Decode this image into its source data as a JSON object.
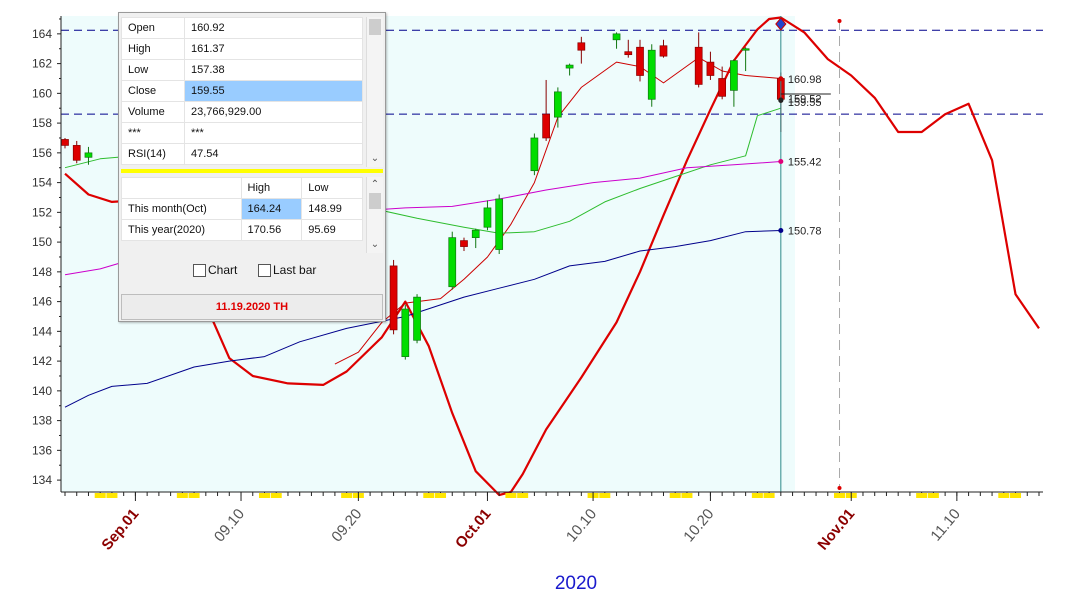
{
  "chart_data": {
    "type": "candlestick",
    "year_label": "2020",
    "x_tick_labels": [
      {
        "date": "2020-09-01",
        "label": "Sep.01",
        "month_start": true
      },
      {
        "date": "2020-09-10",
        "label": "09.10",
        "month_start": false
      },
      {
        "date": "2020-09-20",
        "label": "09.20",
        "month_start": false
      },
      {
        "date": "2020-10-01",
        "label": "Oct.01",
        "month_start": true
      },
      {
        "date": "2020-10-10",
        "label": "10.10",
        "month_start": false
      },
      {
        "date": "2020-10-20",
        "label": "10.20",
        "month_start": false
      },
      {
        "date": "2020-11-01",
        "label": "Nov.01",
        "month_start": true
      },
      {
        "date": "2020-11-10",
        "label": "11.10",
        "month_start": false
      }
    ],
    "y_ticks": [
      134,
      136,
      138,
      140,
      142,
      144,
      146,
      148,
      150,
      152,
      154,
      156,
      158,
      160,
      162,
      164
    ],
    "ylim": [
      133.2,
      165.2
    ],
    "x_domain": [
      "2020-08-26",
      "2020-11-17"
    ],
    "last_date": "2020-10-26",
    "forecast_marker_date": "2020-10-31",
    "horizontal_lines": [
      164.24,
      158.6
    ],
    "price_labels": [
      {
        "label": "160.98",
        "value": 160.98,
        "color": "#d00000"
      },
      {
        "label": "159.52",
        "value": 159.52,
        "color": "#222222"
      },
      {
        "label": "159.55",
        "value": 159.55,
        "color": "#222222"
      },
      {
        "label": "155.42",
        "value": 155.42,
        "color": "#e0007a"
      },
      {
        "label": "150.78",
        "value": 150.78,
        "color": "#00008b"
      }
    ],
    "candles": [
      {
        "date": "2020-08-26",
        "open": 156.9,
        "high": 157.0,
        "low": 156.3,
        "close": 156.5
      },
      {
        "date": "2020-08-27",
        "open": 156.5,
        "high": 156.8,
        "low": 155.3,
        "close": 155.5
      },
      {
        "date": "2020-08-28",
        "open": 155.7,
        "high": 156.4,
        "low": 155.2,
        "close": 156.0
      },
      {
        "date": "2020-08-31",
        "open": 156.5,
        "high": 157.3,
        "low": 156.2,
        "close": 157.1
      },
      {
        "date": "2020-09-22",
        "open": 149.1,
        "high": 149.3,
        "low": 148.6,
        "close": 148.7
      },
      {
        "date": "2020-09-23",
        "open": 148.4,
        "high": 148.8,
        "low": 143.8,
        "close": 144.1
      },
      {
        "date": "2020-09-24",
        "open": 142.3,
        "high": 145.8,
        "low": 142.1,
        "close": 145.5
      },
      {
        "date": "2020-09-25",
        "open": 143.4,
        "high": 146.5,
        "low": 143.2,
        "close": 146.3
      },
      {
        "date": "2020-09-28",
        "open": 147.0,
        "high": 150.7,
        "low": 146.8,
        "close": 150.3
      },
      {
        "date": "2020-09-29",
        "open": 150.1,
        "high": 150.3,
        "low": 149.4,
        "close": 149.7
      },
      {
        "date": "2020-09-30",
        "open": 150.3,
        "high": 150.9,
        "low": 149.6,
        "close": 150.8
      },
      {
        "date": "2020-10-01",
        "open": 151.0,
        "high": 152.8,
        "low": 150.8,
        "close": 152.3
      },
      {
        "date": "2020-10-02",
        "open": 149.5,
        "high": 153.2,
        "low": 149.2,
        "close": 152.9
      },
      {
        "date": "2020-10-05",
        "open": 154.8,
        "high": 157.3,
        "low": 154.5,
        "close": 157.0
      },
      {
        "date": "2020-10-06",
        "open": 158.6,
        "high": 160.9,
        "low": 156.8,
        "close": 157.0
      },
      {
        "date": "2020-10-07",
        "open": 158.4,
        "high": 160.4,
        "low": 157.7,
        "close": 160.1
      },
      {
        "date": "2020-10-08",
        "open": 161.7,
        "high": 162.0,
        "low": 161.2,
        "close": 161.9
      },
      {
        "date": "2020-10-09",
        "open": 163.4,
        "high": 163.8,
        "low": 162.0,
        "close": 162.9
      },
      {
        "date": "2020-10-12",
        "open": 163.6,
        "high": 164.1,
        "low": 163.0,
        "close": 164.0
      },
      {
        "date": "2020-10-13",
        "open": 162.8,
        "high": 163.6,
        "low": 162.4,
        "close": 162.6
      },
      {
        "date": "2020-10-14",
        "open": 163.1,
        "high": 163.6,
        "low": 160.8,
        "close": 161.2
      },
      {
        "date": "2020-10-15",
        "open": 159.6,
        "high": 163.3,
        "low": 159.1,
        "close": 162.9
      },
      {
        "date": "2020-10-16",
        "open": 163.2,
        "high": 163.6,
        "low": 162.4,
        "close": 162.5
      },
      {
        "date": "2020-10-19",
        "open": 163.1,
        "high": 164.1,
        "low": 160.4,
        "close": 160.6
      },
      {
        "date": "2020-10-20",
        "open": 162.1,
        "high": 162.8,
        "low": 160.9,
        "close": 161.2
      },
      {
        "date": "2020-10-21",
        "open": 161.0,
        "high": 161.8,
        "low": 159.6,
        "close": 159.8
      },
      {
        "date": "2020-10-22",
        "open": 160.2,
        "high": 162.3,
        "low": 159.1,
        "close": 162.2
      },
      {
        "date": "2020-10-23",
        "open": 163.0,
        "high": 163.1,
        "low": 161.5,
        "close": 163.0
      },
      {
        "date": "2020-10-26",
        "open": 161.0,
        "high": 161.4,
        "low": 157.4,
        "close": 159.6
      }
    ],
    "series": [
      {
        "color": "#dd0000",
        "width": 2.2,
        "points": [
          [
            "2020-08-26",
            154.6
          ],
          [
            "2020-08-28",
            153.2
          ],
          [
            "2020-08-30",
            152.7
          ],
          [
            "2020-09-01",
            152.8
          ],
          [
            "2020-09-03",
            153.5
          ],
          [
            "2020-09-05",
            152.0
          ],
          [
            "2020-09-07",
            145.8
          ],
          [
            "2020-09-09",
            142.2
          ],
          [
            "2020-09-11",
            141.0
          ],
          [
            "2020-09-14",
            140.5
          ],
          [
            "2020-09-17",
            140.4
          ],
          [
            "2020-09-19",
            141.3
          ],
          [
            "2020-09-22",
            143.6
          ],
          [
            "2020-09-24",
            146.0
          ],
          [
            "2020-09-26",
            143.0
          ],
          [
            "2020-09-28",
            138.5
          ],
          [
            "2020-09-30",
            134.6
          ],
          [
            "2020-10-02",
            133.0
          ],
          [
            "2020-10-03",
            133.2
          ],
          [
            "2020-10-04",
            134.4
          ],
          [
            "2020-10-06",
            137.4
          ],
          [
            "2020-10-09",
            140.9
          ],
          [
            "2020-10-12",
            144.6
          ],
          [
            "2020-10-14",
            148.0
          ],
          [
            "2020-10-16",
            151.8
          ],
          [
            "2020-10-18",
            155.5
          ],
          [
            "2020-10-20",
            158.9
          ],
          [
            "2020-10-22",
            162.2
          ],
          [
            "2020-10-24",
            164.3
          ],
          [
            "2020-10-25",
            165.0
          ],
          [
            "2020-10-26",
            165.1
          ],
          [
            "2020-10-28",
            164.1
          ],
          [
            "2020-10-30",
            162.3
          ],
          [
            "2020-11-01",
            161.2
          ],
          [
            "2020-11-03",
            159.7
          ],
          [
            "2020-11-05",
            157.4
          ],
          [
            "2020-11-07",
            157.4
          ],
          [
            "2020-11-09",
            158.6
          ],
          [
            "2020-11-11",
            159.3
          ],
          [
            "2020-11-13",
            155.5
          ],
          [
            "2020-11-15",
            146.5
          ],
          [
            "2020-11-17",
            144.2
          ]
        ]
      },
      {
        "color": "#cc0000",
        "width": 1,
        "points": [
          [
            "2020-09-18",
            141.8
          ],
          [
            "2020-09-20",
            142.6
          ],
          [
            "2020-09-22",
            144.6
          ],
          [
            "2020-09-24",
            145.9
          ],
          [
            "2020-09-27",
            146.2
          ],
          [
            "2020-09-29",
            147.5
          ],
          [
            "2020-10-01",
            149.0
          ],
          [
            "2020-10-03",
            151.2
          ],
          [
            "2020-10-05",
            154.0
          ],
          [
            "2020-10-07",
            158.4
          ],
          [
            "2020-10-09",
            160.4
          ],
          [
            "2020-10-12",
            162.1
          ],
          [
            "2020-10-14",
            161.8
          ],
          [
            "2020-10-16",
            160.7
          ],
          [
            "2020-10-19",
            162.4
          ],
          [
            "2020-10-21",
            161.5
          ],
          [
            "2020-10-23",
            161.2
          ],
          [
            "2020-10-26",
            161.0
          ]
        ]
      },
      {
        "color": "#2ebd2e",
        "width": 1,
        "points": [
          [
            "2020-08-26",
            155.0
          ],
          [
            "2020-08-29",
            155.6
          ],
          [
            "2020-09-01",
            155.8
          ],
          [
            "2020-09-05",
            155.2
          ],
          [
            "2020-09-09",
            154.6
          ],
          [
            "2020-09-13",
            153.4
          ],
          [
            "2020-09-17",
            152.7
          ],
          [
            "2020-09-21",
            152.3
          ],
          [
            "2020-09-25",
            151.6
          ],
          [
            "2020-09-29",
            151.0
          ],
          [
            "2020-10-02",
            150.6
          ],
          [
            "2020-10-05",
            150.7
          ],
          [
            "2020-10-08",
            151.4
          ],
          [
            "2020-10-11",
            152.7
          ],
          [
            "2020-10-14",
            153.6
          ],
          [
            "2020-10-17",
            154.4
          ],
          [
            "2020-10-20",
            155.2
          ],
          [
            "2020-10-23",
            155.8
          ],
          [
            "2020-10-24",
            158.5
          ],
          [
            "2020-10-26",
            159.0
          ]
        ]
      },
      {
        "color": "#cc00cc",
        "width": 1,
        "points": [
          [
            "2020-08-26",
            147.8
          ],
          [
            "2020-08-29",
            148.2
          ],
          [
            "2020-09-01",
            148.9
          ],
          [
            "2020-09-05",
            149.1
          ],
          [
            "2020-09-10",
            149.8
          ],
          [
            "2020-09-15",
            151.1
          ],
          [
            "2020-09-20",
            152.1
          ],
          [
            "2020-09-24",
            152.3
          ],
          [
            "2020-09-28",
            152.4
          ],
          [
            "2020-10-02",
            152.9
          ],
          [
            "2020-10-06",
            153.5
          ],
          [
            "2020-10-10",
            154.0
          ],
          [
            "2020-10-14",
            154.3
          ],
          [
            "2020-10-18",
            155.0
          ],
          [
            "2020-10-22",
            155.2
          ],
          [
            "2020-10-26",
            155.42
          ]
        ]
      },
      {
        "color": "#00008b",
        "width": 1,
        "points": [
          [
            "2020-08-26",
            138.9
          ],
          [
            "2020-08-28",
            139.7
          ],
          [
            "2020-08-30",
            140.3
          ],
          [
            "2020-09-02",
            140.5
          ],
          [
            "2020-09-06",
            141.6
          ],
          [
            "2020-09-09",
            142.0
          ],
          [
            "2020-09-12",
            142.3
          ],
          [
            "2020-09-15",
            143.3
          ],
          [
            "2020-09-19",
            144.2
          ],
          [
            "2020-09-24",
            145.0
          ],
          [
            "2020-09-29",
            146.3
          ],
          [
            "2020-10-02",
            146.9
          ],
          [
            "2020-10-05",
            147.5
          ],
          [
            "2020-10-08",
            148.4
          ],
          [
            "2020-10-11",
            148.7
          ],
          [
            "2020-10-14",
            149.4
          ],
          [
            "2020-10-17",
            149.7
          ],
          [
            "2020-10-20",
            150.1
          ],
          [
            "2020-10-23",
            150.7
          ],
          [
            "2020-10-26",
            150.78
          ]
        ]
      }
    ],
    "weekend_days": [
      "2020-08-29",
      "2020-08-30",
      "2020-09-05",
      "2020-09-06",
      "2020-09-12",
      "2020-09-13",
      "2020-09-19",
      "2020-09-20",
      "2020-09-26",
      "2020-09-27",
      "2020-10-03",
      "2020-10-04",
      "2020-10-10",
      "2020-10-11",
      "2020-10-17",
      "2020-10-18",
      "2020-10-24",
      "2020-10-25",
      "2020-10-31",
      "2020-11-01",
      "2020-11-07",
      "2020-11-08",
      "2020-11-14",
      "2020-11-15"
    ]
  },
  "info_panel": {
    "quote_rows": [
      {
        "label": "Open",
        "value": "160.92"
      },
      {
        "label": "High",
        "value": "161.37"
      },
      {
        "label": "Low",
        "value": "157.38"
      },
      {
        "label": "Close",
        "value": "159.55"
      },
      {
        "label": "Volume",
        "value": "23,766,929.00"
      },
      {
        "label": "***",
        "value": "***"
      },
      {
        "label": "RSI(14)",
        "value": "47.54"
      }
    ],
    "hilo_header": {
      "high": "High",
      "low": "Low"
    },
    "hilo_rows": [
      {
        "label": "This month(Oct)",
        "high": "164.24",
        "low": "148.99"
      },
      {
        "label": "This year(2020)",
        "high": "170.56",
        "low": "95.69"
      }
    ],
    "chart_checkbox_label": "Chart",
    "lastbar_checkbox_label": "Last bar",
    "selected_date": "11.19.2020 TH"
  },
  "colors": {
    "plot_bg": "#eefcfc",
    "up": "#00dd00",
    "down": "#dd0000",
    "weekend_marker": "#ffe600",
    "month_label": "#8b0000",
    "year_label": "#1a1acc"
  }
}
